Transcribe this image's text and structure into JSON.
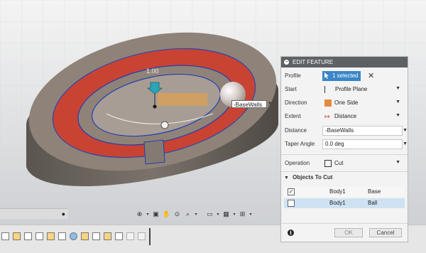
{
  "viewport": {
    "dimension_label": "1.00",
    "distance_value": "-BaseWalls"
  },
  "dialog": {
    "title": "EDIT FEATURE",
    "profile": {
      "label": "Profile",
      "value": "1 selected",
      "clear_icon": "close-icon"
    },
    "start": {
      "label": "Start",
      "value": "Profile Plane"
    },
    "direction": {
      "label": "Direction",
      "value": "One Side"
    },
    "extent": {
      "label": "Extent",
      "value": "Distance"
    },
    "distance": {
      "label": "Distance",
      "value": "-BaseWalls"
    },
    "taper_angle": {
      "label": "Taper Angle",
      "value": "0.0 deg"
    },
    "operation": {
      "label": "Operation",
      "value": "Cut"
    },
    "objects_to_cut": {
      "title": "Objects To Cut",
      "rows": [
        {
          "checked": true,
          "body": "Body1",
          "component": "Base"
        },
        {
          "checked": false,
          "body": "Body1",
          "component": "Ball"
        }
      ]
    },
    "ok_label": "OK",
    "cancel_label": "Cancel"
  },
  "colors": {
    "accent": "#3a86c8",
    "header": "#5d6166",
    "cut_red": "#d13b2a",
    "body_taupe": "#8f8379"
  }
}
